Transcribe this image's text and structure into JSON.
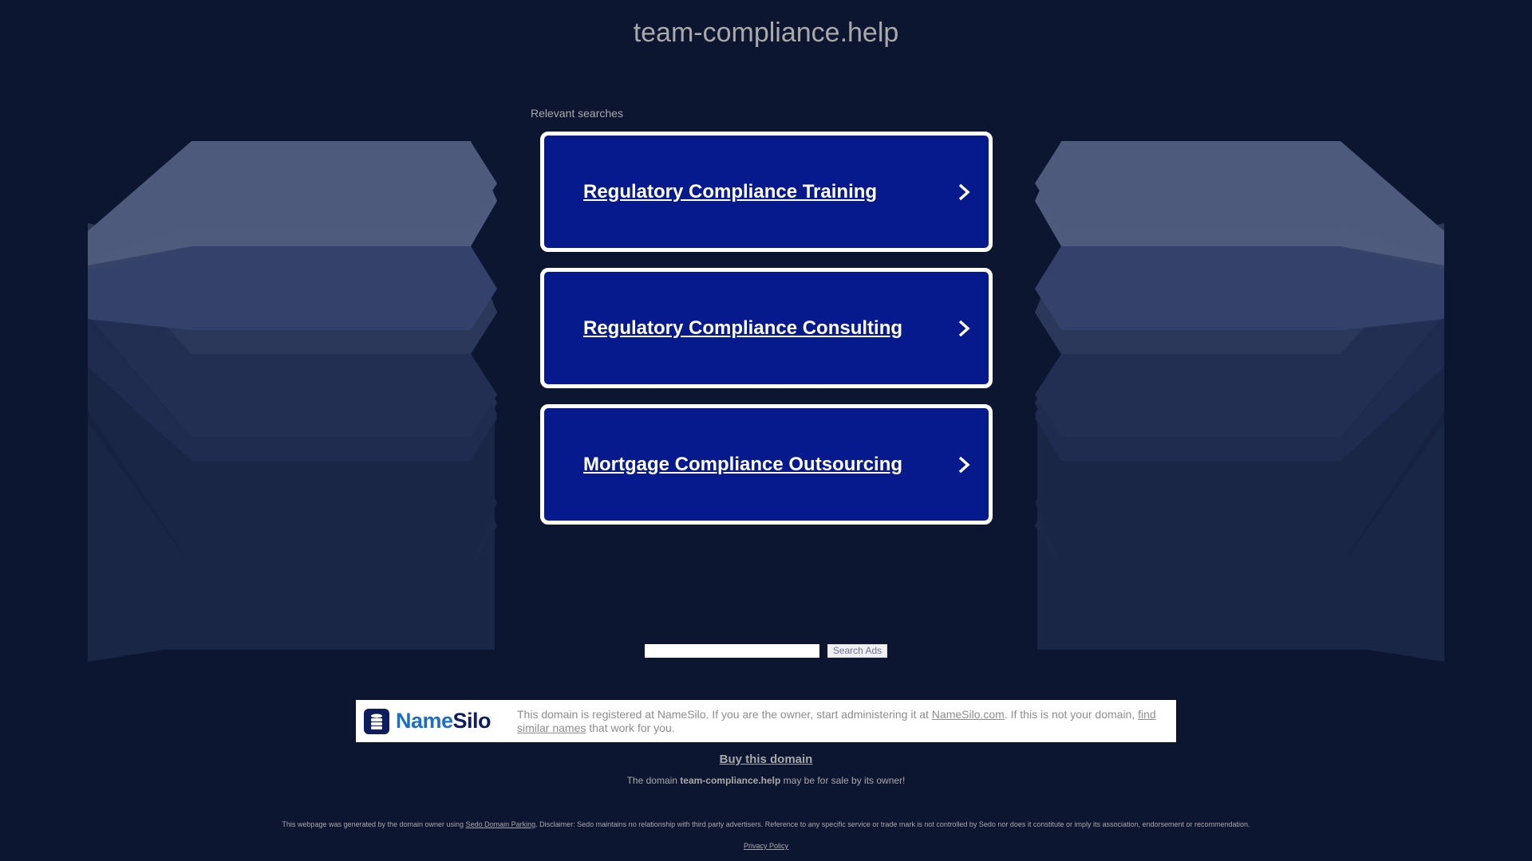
{
  "page": {
    "title": "team-compliance.help",
    "relevant_label": "Relevant searches"
  },
  "search_links": [
    {
      "label": "Regulatory Compliance Training"
    },
    {
      "label": "Regulatory Compliance Consulting"
    },
    {
      "label": "Mortgage Compliance Outsourcing"
    }
  ],
  "search_form": {
    "input_value": "",
    "button_label": "Search Ads"
  },
  "registrar": {
    "logo_name": "Name",
    "logo_silo": "Silo",
    "text_before_link": "This domain is registered at NameSilo. If you are the owner, start administering it at ",
    "link_label": "NameSilo.com",
    "text_after_link": ". If this is not your domain, ",
    "similar_link_label": "find similar names",
    "text_end": " that work for you."
  },
  "buy_domain_label": "Buy this domain",
  "for_sale": {
    "prefix": "The domain ",
    "domain": "team-compliance.help",
    "suffix": " may be for sale by its owner!"
  },
  "disclaimer": {
    "prefix": "This webpage was generated by the domain owner using ",
    "link_label": "Sedo Domain Parking",
    "suffix": ". Disclaimer: Sedo maintains no relationship with third party advertisers. Reference to any specific service or trade mark is not controlled by Sedo nor does it constitute or imply its association, endorsement or recommendation."
  },
  "privacy_label": "Privacy Policy",
  "colors": {
    "background": "#0d1630",
    "card_background": "#061a8d",
    "card_border": "#ffffff",
    "deco_light": "#4e5b7c",
    "deco_mid": "#2f3d61",
    "deco_dark": "#1b2747",
    "text_muted": "#a9a9a9"
  },
  "icons": {
    "chevron": "chevron-right-icon",
    "logo": "namesilo-logo-icon"
  }
}
